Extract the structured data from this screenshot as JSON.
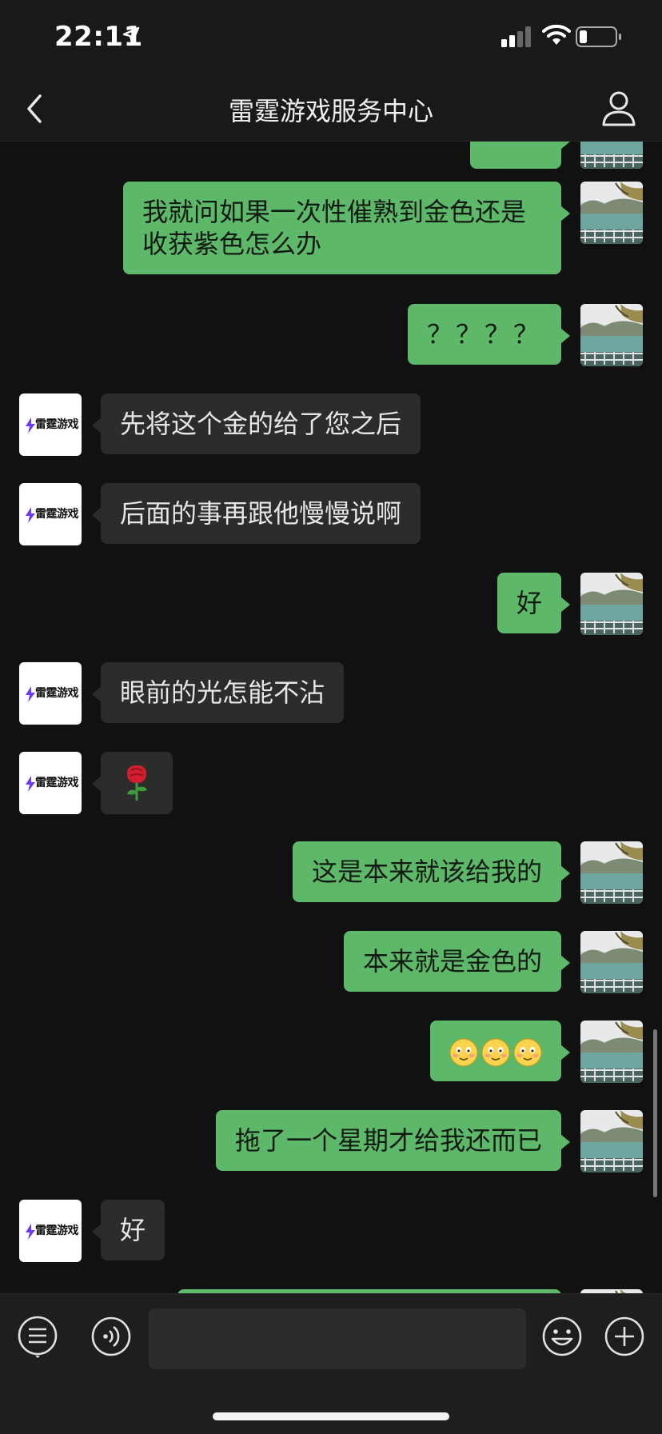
{
  "status_bar": {
    "time": "22:11"
  },
  "header": {
    "title": "雷霆游戏服务中心"
  },
  "service_logo": {
    "text": "雷霆游戏"
  },
  "messages": [
    {
      "side": "out",
      "text": "我就问如果一次性催熟到金色还是收获紫色怎么办"
    },
    {
      "side": "out",
      "text": "？？？？"
    },
    {
      "side": "in",
      "text": "先将这个金的给了您之后"
    },
    {
      "side": "in",
      "text": "后面的事再跟他慢慢说啊"
    },
    {
      "side": "out",
      "text": "好"
    },
    {
      "side": "in",
      "text": "眼前的光怎能不沾"
    },
    {
      "side": "in",
      "sticker": "rose",
      "text": "🌹"
    },
    {
      "side": "out",
      "text": "这是本来就该给我的"
    },
    {
      "side": "out",
      "text": "本来就是金色的"
    },
    {
      "side": "out",
      "emoji": "blush",
      "count": 3
    },
    {
      "side": "out",
      "text": "拖了一个星期才给我还而已"
    },
    {
      "side": "in",
      "text": "好"
    }
  ],
  "icons": {
    "back": "chevron-left-icon",
    "profile": "person-icon",
    "menu": "list-icon",
    "voice": "voice-icon",
    "emoji": "smiley-icon",
    "add": "plus-icon"
  },
  "colors": {
    "outgoing_bubble": "#5eb86a",
    "incoming_bubble": "#2c2c2c",
    "background": "#111111"
  }
}
